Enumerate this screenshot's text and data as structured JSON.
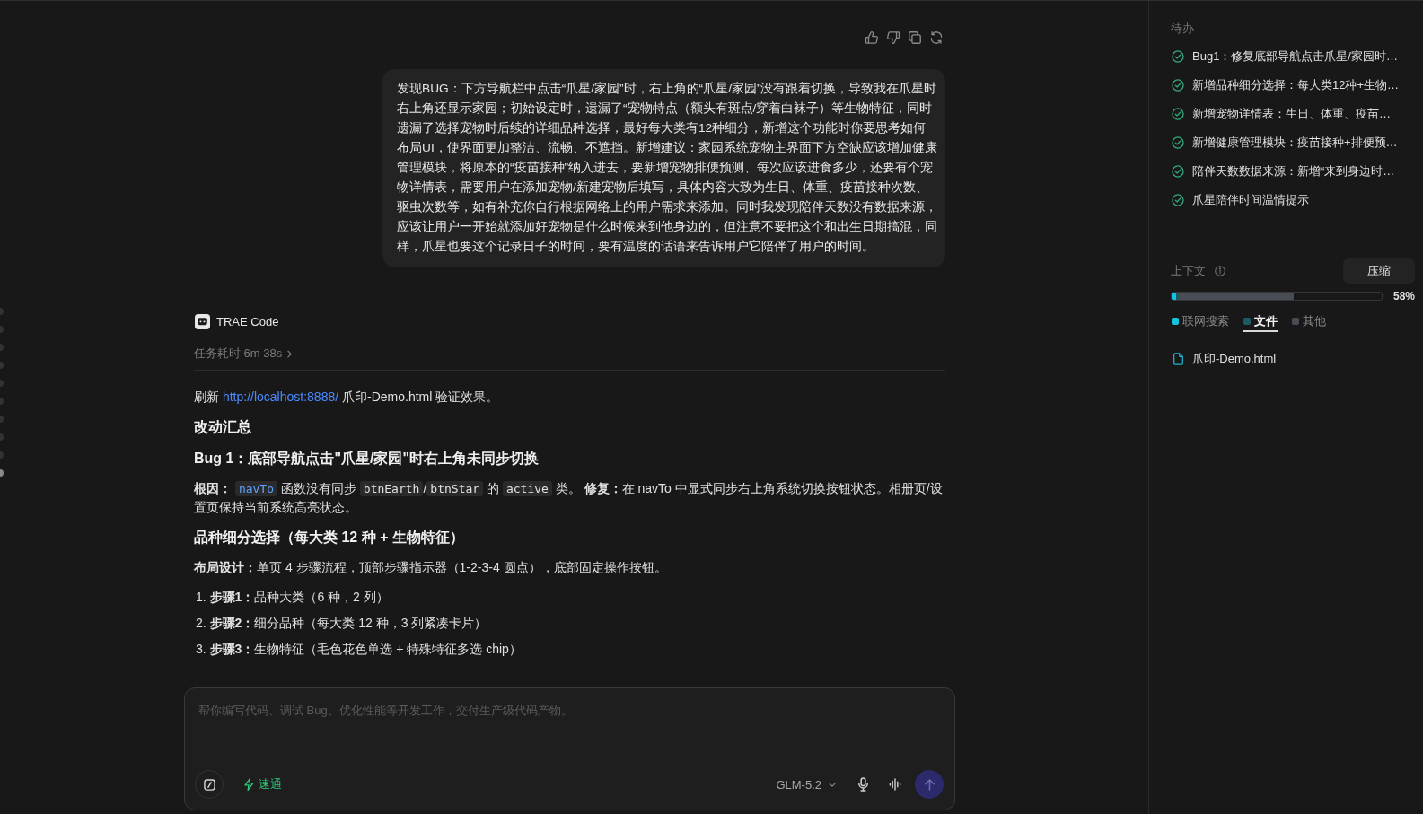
{
  "turn_markers": [
    {
      "selected": false
    },
    {
      "selected": false
    },
    {
      "selected": false
    },
    {
      "selected": false
    },
    {
      "selected": false
    },
    {
      "selected": false
    },
    {
      "selected": false
    },
    {
      "selected": false
    },
    {
      "selected": false
    },
    {
      "selected": true
    }
  ],
  "user_message": {
    "text": "发现BUG：下方导航栏中点击“爪星/家园”时，右上角的“爪星/家园”没有跟着切换，导致我在爪星时右上角还显示家园；初始设定时，遗漏了“宠物特点（额头有斑点/穿着白袜子）等生物特征，同时遗漏了选择宠物时后续的详细品种选择，最好每大类有12种细分，新增这个功能时你要思考如何布局UI，使界面更加整洁、流畅、不遮挡。新增建议：家园系统宠物主界面下方空缺应该增加健康管理模块，将原本的“疫苗接种”纳入进去，要新增宠物排便预测、每次应该进食多少，还要有个宠物详情表，需要用户在添加宠物/新建宠物后填写，具体内容大致为生日、体重、疫苗接种次数、驱虫次数等，如有补充你自行根据网络上的用户需求来添加。同时我发现陪伴天数没有数据来源，应该让用户一开始就添加好宠物是什么时候来到他身边的，但注意不要把这个和出生日期搞混，同样，爪星也要这个记录日子的时间，要有温度的话语来告诉用户它陪伴了用户的时间。"
  },
  "response": {
    "agent": "TRAE Code",
    "duration": "任务耗时 6m 38s",
    "blocks": [
      {
        "kind": "paragraph",
        "segments": [
          {
            "kind": "text",
            "text": "刷新 "
          },
          {
            "kind": "link",
            "text": "http://localhost:8888/"
          },
          {
            "kind": "text",
            "text": " 爪印-Demo.html 验证效果。"
          }
        ]
      },
      {
        "kind": "heading",
        "text": "改动汇总"
      },
      {
        "kind": "heading",
        "text": "Bug 1：底部导航点击\"爪星/家园\"时右上角未同步切换"
      },
      {
        "kind": "paragraph",
        "segments": [
          {
            "kind": "text",
            "text": "**根因：** "
          },
          {
            "kind": "code_link",
            "text": "navTo"
          },
          {
            "kind": "text",
            "text": " 函数没有同步 "
          },
          {
            "kind": "code",
            "text": "btnEarth"
          },
          {
            "kind": "text",
            "text": "/"
          },
          {
            "kind": "code",
            "text": "btnStar"
          },
          {
            "kind": "text",
            "text": " 的 "
          },
          {
            "kind": "code",
            "text": "active"
          },
          {
            "kind": "text",
            "text": " 类。 **修复：**在 navTo 中显式同步右上角系统切换按钮状态。相册页/设置页保持当前系统高亮状态。"
          }
        ]
      },
      {
        "kind": "heading",
        "text": "品种细分选择（每大类 12 种 + 生物特征）"
      },
      {
        "kind": "paragraph",
        "segments": [
          {
            "kind": "text",
            "text": "**布局设计：**单页 4 步骤流程，顶部步骤指示器（1-2-3-4 圆点），底部固定操作按钮。"
          }
        ]
      },
      {
        "kind": "list_item",
        "text": "1. **步骤1：**品种大类（6 种，2 列）"
      },
      {
        "kind": "list_item",
        "text": "2. **步骤2：**细分品种（每大类 12 种，3 列紧凑卡片）"
      },
      {
        "kind": "list_item",
        "text": "3. **步骤3：**生物特征（毛色花色单选 + 特殊特征多选 chip）"
      }
    ]
  },
  "composer": {
    "placeholder": "帮你编写代码、调试 Bug、优化性能等开发工作，交付生产级代码产物。",
    "mode": "速通",
    "model": "GLM-5.2"
  },
  "sidebar": {
    "todo_title": "待办",
    "todos": [
      {
        "text": "Bug1：修复底部导航点击爪星/家园时…",
        "done": true
      },
      {
        "text": "新增品种细分选择：每大类12种+生物…",
        "done": true
      },
      {
        "text": "新增宠物详情表：生日、体重、疫苗…",
        "done": true
      },
      {
        "text": "新增健康管理模块：疫苗接种+排便预…",
        "done": true
      },
      {
        "text": "陪伴天数数据来源：新增“来到身边时…",
        "done": true
      },
      {
        "text": "爪星陪伴时间温情提示",
        "done": true
      }
    ],
    "context": {
      "title": "上下文",
      "compress_button": "压缩",
      "percent": "58%",
      "usage_layers": [
        {
          "color": "#14c3e0",
          "level": 0.02
        },
        {
          "color": "#1c5a66",
          "level": 0.035
        },
        {
          "color": "#4a4c55",
          "level": 0.58
        }
      ],
      "legend": [
        {
          "label": "联网搜索",
          "color": "#14c3e0",
          "selected": false
        },
        {
          "label": "文件",
          "color": "#1c5a66",
          "selected": true
        },
        {
          "label": "其他",
          "color": "#4a4c55",
          "selected": false
        }
      ]
    },
    "files": [
      {
        "name": "爪印-Demo.html"
      }
    ]
  }
}
